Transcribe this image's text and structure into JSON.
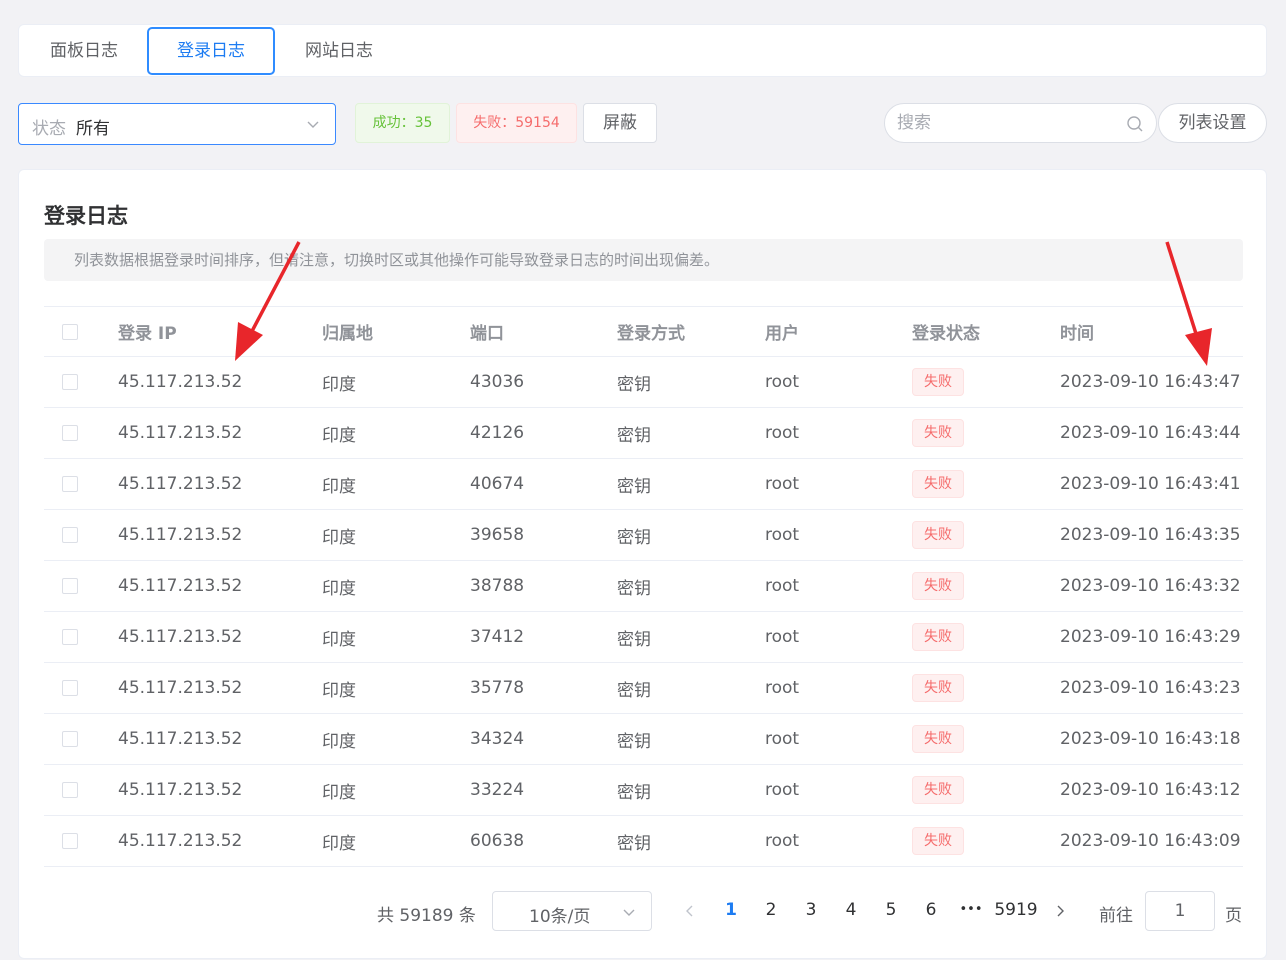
{
  "tabs": [
    {
      "label": "面板日志"
    },
    {
      "label": "登录日志"
    },
    {
      "label": "网站日志"
    }
  ],
  "active_tab": "登录日志",
  "toolbar": {
    "status_label": "状态",
    "status_value": "所有",
    "success_badge": "成功：35",
    "fail_badge": "失败：59154",
    "block_label": "屏蔽",
    "search_placeholder": "搜索",
    "settings_label": "列表设置"
  },
  "main": {
    "title": "登录日志",
    "notice": "列表数据根据登录时间排序，但请注意，切换时区或其他操作可能导致登录日志的时间出现偏差。"
  },
  "table": {
    "columns": [
      "登录 IP",
      "归属地",
      "端口",
      "登录方式",
      "用户",
      "登录状态",
      "时间"
    ],
    "rows": [
      {
        "ip": "45.117.213.52",
        "region": "印度",
        "port": "43036",
        "method": "密钥",
        "user": "root",
        "status": "失败",
        "time": "2023-09-10 16:43:47"
      },
      {
        "ip": "45.117.213.52",
        "region": "印度",
        "port": "42126",
        "method": "密钥",
        "user": "root",
        "status": "失败",
        "time": "2023-09-10 16:43:44"
      },
      {
        "ip": "45.117.213.52",
        "region": "印度",
        "port": "40674",
        "method": "密钥",
        "user": "root",
        "status": "失败",
        "time": "2023-09-10 16:43:41"
      },
      {
        "ip": "45.117.213.52",
        "region": "印度",
        "port": "39658",
        "method": "密钥",
        "user": "root",
        "status": "失败",
        "time": "2023-09-10 16:43:35"
      },
      {
        "ip": "45.117.213.52",
        "region": "印度",
        "port": "38788",
        "method": "密钥",
        "user": "root",
        "status": "失败",
        "time": "2023-09-10 16:43:32"
      },
      {
        "ip": "45.117.213.52",
        "region": "印度",
        "port": "37412",
        "method": "密钥",
        "user": "root",
        "status": "失败",
        "time": "2023-09-10 16:43:29"
      },
      {
        "ip": "45.117.213.52",
        "region": "印度",
        "port": "35778",
        "method": "密钥",
        "user": "root",
        "status": "失败",
        "time": "2023-09-10 16:43:23"
      },
      {
        "ip": "45.117.213.52",
        "region": "印度",
        "port": "34324",
        "method": "密钥",
        "user": "root",
        "status": "失败",
        "time": "2023-09-10 16:43:18"
      },
      {
        "ip": "45.117.213.52",
        "region": "印度",
        "port": "33224",
        "method": "密钥",
        "user": "root",
        "status": "失败",
        "time": "2023-09-10 16:43:12"
      },
      {
        "ip": "45.117.213.52",
        "region": "印度",
        "port": "60638",
        "method": "密钥",
        "user": "root",
        "status": "失败",
        "time": "2023-09-10 16:43:09"
      }
    ]
  },
  "pagination": {
    "total": "共 59189 条",
    "page_size": "10条/页",
    "pages": [
      "1",
      "2",
      "3",
      "4",
      "5",
      "6"
    ],
    "ellipsis": "•••",
    "last_page": "5919",
    "current_page": "1",
    "goto_label": "前往",
    "goto_value": "1",
    "goto_unit": "页"
  },
  "colors": {
    "accent": "#1d7cf2",
    "success": "#67c23a",
    "danger": "#f56c6c",
    "annotation_arrow": "#e8262b"
  },
  "icons": [
    "chevron-down-icon",
    "search-icon",
    "chevron-left-icon",
    "chevron-right-icon",
    "red-arrow-annotation"
  ]
}
